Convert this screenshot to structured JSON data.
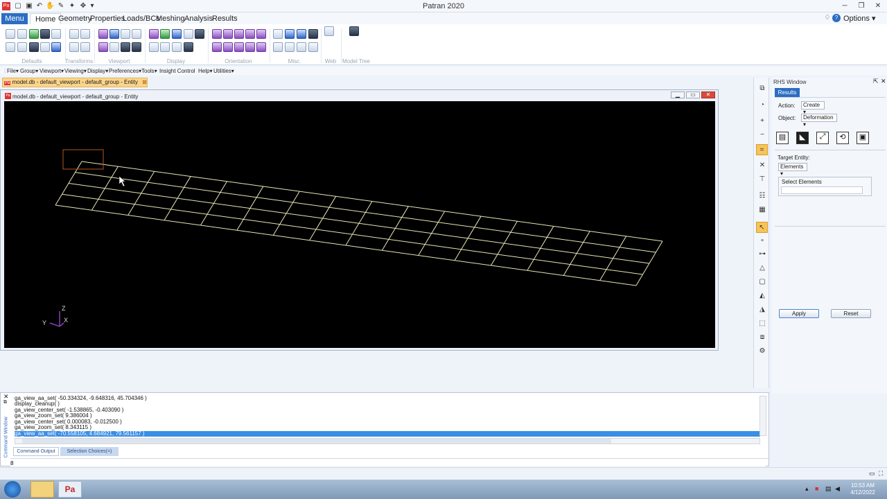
{
  "app": {
    "title": "Patran 2020"
  },
  "tabs": [
    "Menu",
    "Home",
    "Geometry",
    "Properties",
    "Loads/BCs",
    "Meshing",
    "Analysis",
    "Results"
  ],
  "options_label": "Options",
  "ribbon_groups": [
    "Defaults",
    "Transforms",
    "Viewport",
    "Display",
    "Orientation",
    "Misc.",
    "Web",
    "Model Tree"
  ],
  "menubar": [
    "File",
    "Group",
    "Viewport",
    "Viewing",
    "Display",
    "Preferences",
    "Tools",
    "Insight Control",
    "Help",
    "Utilities"
  ],
  "doc_tab": "model.db - default_viewport - default_group - Entity",
  "viewport_title": "model.db - default_viewport - default_group - Entity",
  "axes": {
    "z": "Z",
    "y": "Y",
    "x": "X"
  },
  "rhs": {
    "window_title": "RHS Window",
    "tab": "Results",
    "action_label": "Action:",
    "action_value": "Create",
    "object_label": "Object:",
    "object_value": "Deformation",
    "target_label": "Target Entity:",
    "target_value": "Elements",
    "select_label": "Select Elements",
    "select_value": "",
    "apply": "Apply",
    "reset": "Reset"
  },
  "command": {
    "lines": [
      "ga_view_aa_set( -50.334324, -9.648316, 45.704346 )",
      "display_cleanup( )",
      "ga_view_center_set( -1.538865, -0.403090 )",
      "ga_view_zoom_set( 9.386004 )",
      "ga_view_center_set( 0.000083, -0.012500 )",
      "ga_view_zoom_set( 8.343115 )",
      "ga_view_aa_set( -70.558105, 4.684921, 79.561157 )"
    ],
    "tabs": [
      "Command Output",
      "Selection Choices(=)"
    ],
    "side_label": "Command Window",
    "input": "8"
  },
  "clock": {
    "time": "10:53 AM",
    "date": "4/12/2022"
  },
  "colors": {
    "accent": "#2c6dc2",
    "mesh": "#e9e6b8",
    "viewport_bg": "#000000"
  }
}
